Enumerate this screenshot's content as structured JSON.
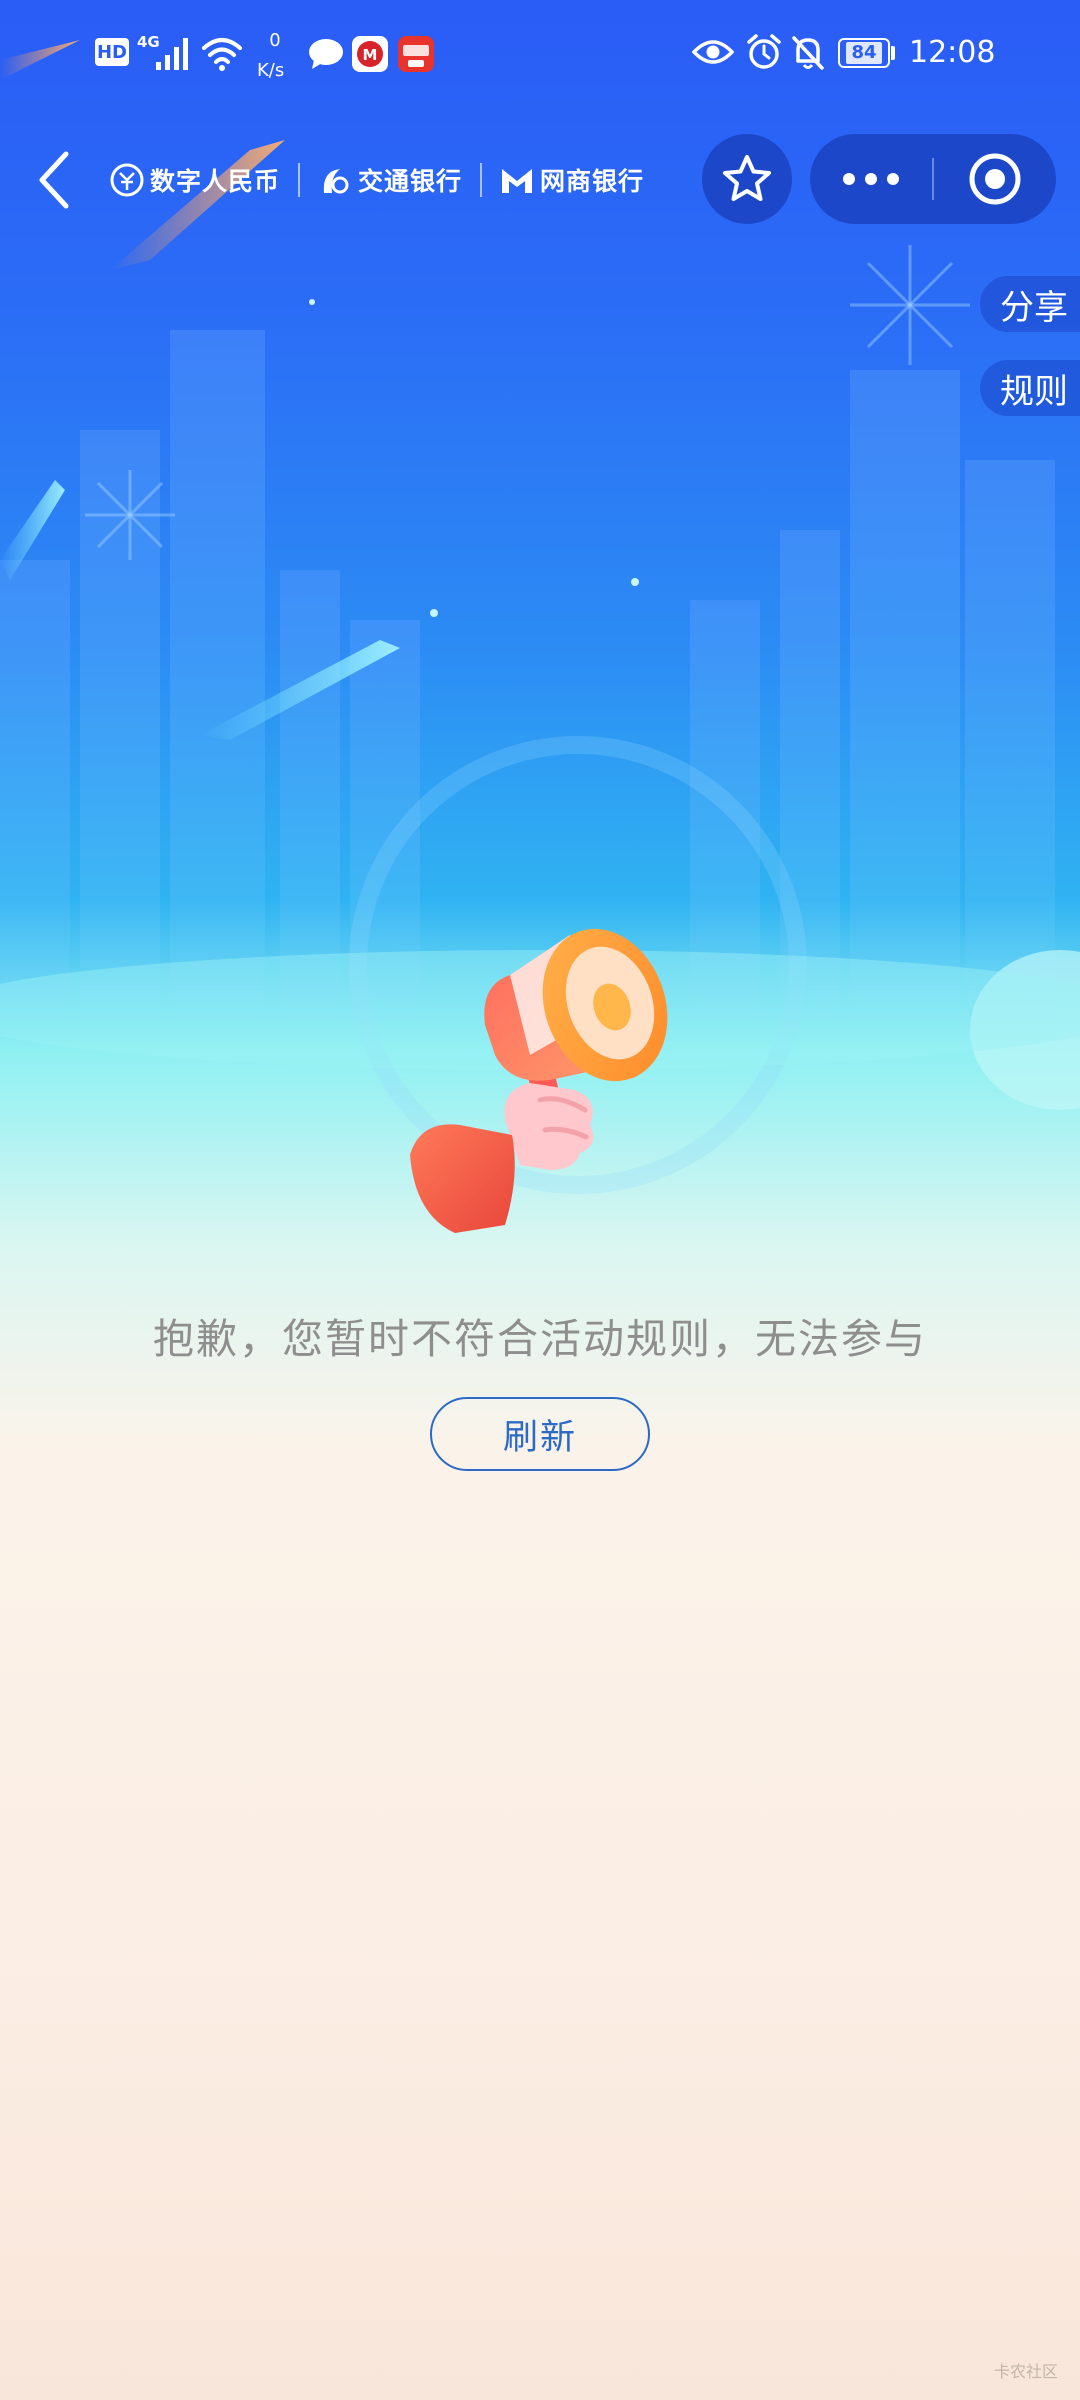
{
  "status_bar": {
    "hd": "HD",
    "network": "4G",
    "speed_value": "0",
    "speed_unit": "K/s",
    "battery": "84",
    "time": "12:08"
  },
  "nav": {
    "brands": [
      "数字人民币",
      "交通银行",
      "网商银行"
    ]
  },
  "side_tabs": {
    "share": "分享",
    "rules": "规则"
  },
  "content": {
    "message": "抱歉，您暂时不符合活动规则，无法参与",
    "refresh_label": "刷新"
  },
  "watermark": "卡农社区",
  "colors": {
    "header_blue": "#2a5cf6",
    "capsule_blue": "#1d47c9",
    "accent_blue": "#2c6ac6",
    "message_gray": "#8e8e8e"
  }
}
